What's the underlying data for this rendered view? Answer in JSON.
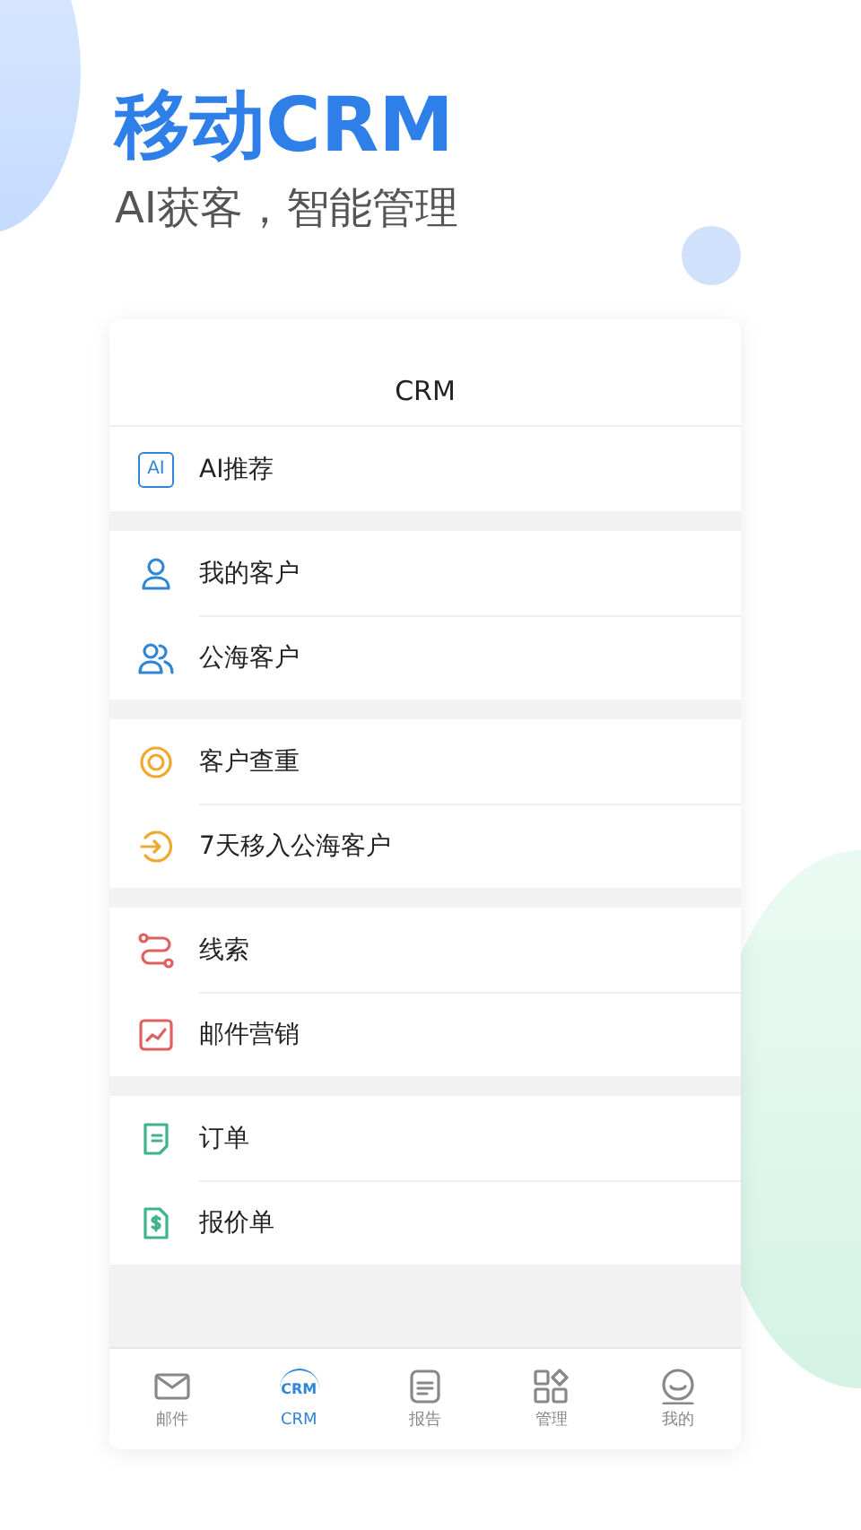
{
  "headline": {
    "title": "移动CRM",
    "subtitle": "AI获客，智能管理"
  },
  "screen": {
    "title": "CRM",
    "groups": [
      {
        "color": "#2f86d6",
        "items": [
          {
            "label": "AI推荐",
            "kind": "badge",
            "icon_text": "AI"
          }
        ]
      },
      {
        "color": "#2f86d6",
        "items": [
          {
            "label": "我的客户",
            "kind": "person"
          },
          {
            "label": "公海客户",
            "kind": "people"
          }
        ]
      },
      {
        "color": "#f0a830",
        "items": [
          {
            "label": "客户查重",
            "kind": "ring"
          },
          {
            "label": "7天移入公海客户",
            "kind": "enter"
          }
        ]
      },
      {
        "color": "#e06060",
        "items": [
          {
            "label": "线索",
            "kind": "route"
          },
          {
            "label": "邮件营销",
            "kind": "chart"
          }
        ]
      },
      {
        "color": "#3fb38a",
        "items": [
          {
            "label": "订单",
            "kind": "doc"
          },
          {
            "label": "报价单",
            "kind": "invoice"
          }
        ]
      }
    ],
    "tabs": [
      {
        "label": "邮件",
        "kind": "mail",
        "selected": false
      },
      {
        "label": "CRM",
        "kind": "crm",
        "icon_text": "CRM",
        "selected": true
      },
      {
        "label": "报告",
        "kind": "report",
        "selected": false
      },
      {
        "label": "管理",
        "kind": "grid",
        "selected": false
      },
      {
        "label": "我的",
        "kind": "face",
        "selected": false
      }
    ]
  }
}
